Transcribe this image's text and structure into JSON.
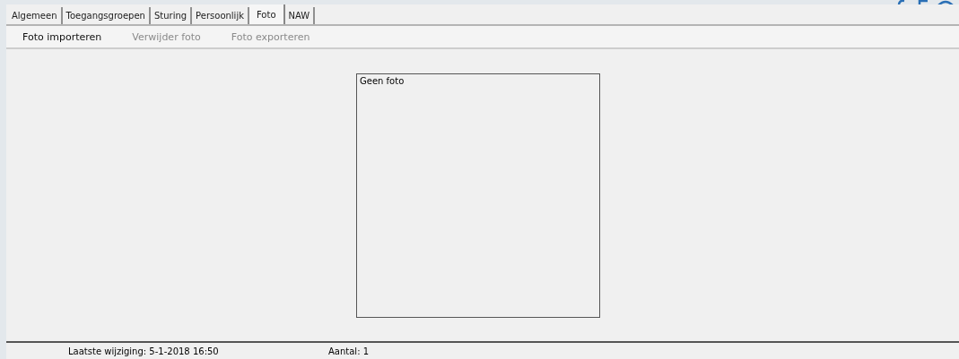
{
  "tabs": [
    {
      "label": "Algemeen",
      "selected": false
    },
    {
      "label": "Toegangsgroepen",
      "selected": false
    },
    {
      "label": "Sturing",
      "selected": false
    },
    {
      "label": "Persoonlijk",
      "selected": false
    },
    {
      "label": "Foto",
      "selected": true
    },
    {
      "label": "NAW",
      "selected": false
    }
  ],
  "toolbar": [
    {
      "label": "Foto importeren",
      "disabled": false
    },
    {
      "label": "Verwijder foto",
      "disabled": true
    },
    {
      "label": "Foto exporteren",
      "disabled": true
    }
  ],
  "photo": {
    "placeholder_text": "Geen foto"
  },
  "status_bar": {
    "last_modified": "Laatste wijziging: 5-1-2018 16:50",
    "count": "Aantal: 1"
  }
}
